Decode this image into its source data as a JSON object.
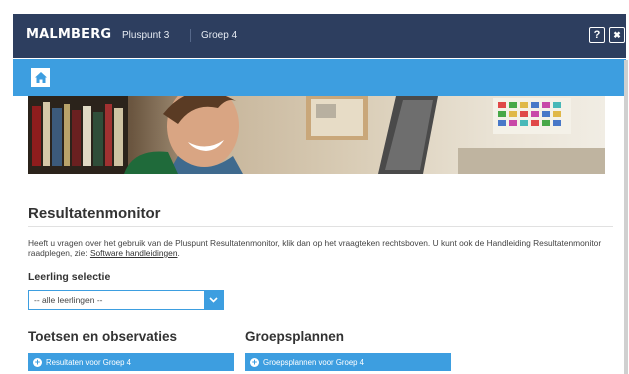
{
  "header": {
    "logo": "MALMBERG",
    "nav": [
      "Pluspunt 3",
      "Groep 4"
    ],
    "help_label": "?",
    "close_label": "✖"
  },
  "main": {
    "title": "Resultatenmonitor",
    "intro_text": "Heeft u vragen over het gebruik van de Pluspunt Resultatenmonitor, klik dan op het vraagteken rechtsboven. U kunt ook de Handleiding Resultatenmonitor raadplegen, zie: ",
    "intro_link": "Software handleidingen",
    "intro_end": ".",
    "selection_label": "Leerling selectie",
    "select_value": "-- alle leerlingen --",
    "sections": [
      {
        "title": "Toetsen en observaties",
        "button_label": "Resultaten voor Groep 4"
      },
      {
        "title": "Groepsplannen",
        "button_label": "Groepsplannen voor Groep 4"
      }
    ]
  },
  "colors": {
    "header_bg": "#2d3e5f",
    "accent_blue": "#3d9ee0"
  },
  "icons": [
    "home-icon",
    "help-icon",
    "close-icon",
    "chevron-down-icon",
    "plus-circle-icon"
  ]
}
